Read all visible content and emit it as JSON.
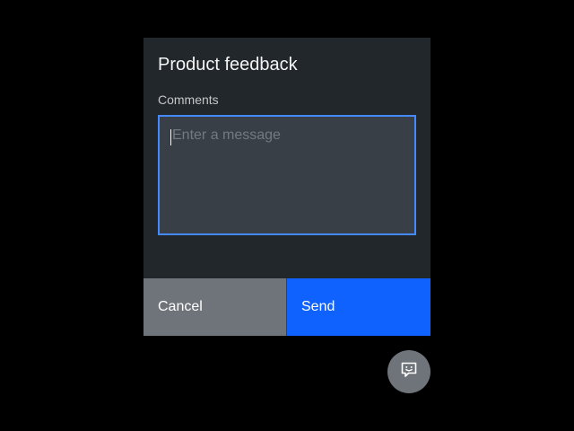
{
  "dialog": {
    "title": "Product feedback",
    "comments_label": "Comments",
    "comments_value": "",
    "comments_placeholder": "Enter a message",
    "cancel_label": "Cancel",
    "send_label": "Send"
  },
  "fab": {
    "icon": "feedback-chat-icon"
  },
  "colors": {
    "background": "#000000",
    "dialog": "#22272c",
    "field": "#393f46",
    "focus_border": "#4589ff",
    "primary": "#0f62fe",
    "secondary": "#6f747b"
  }
}
